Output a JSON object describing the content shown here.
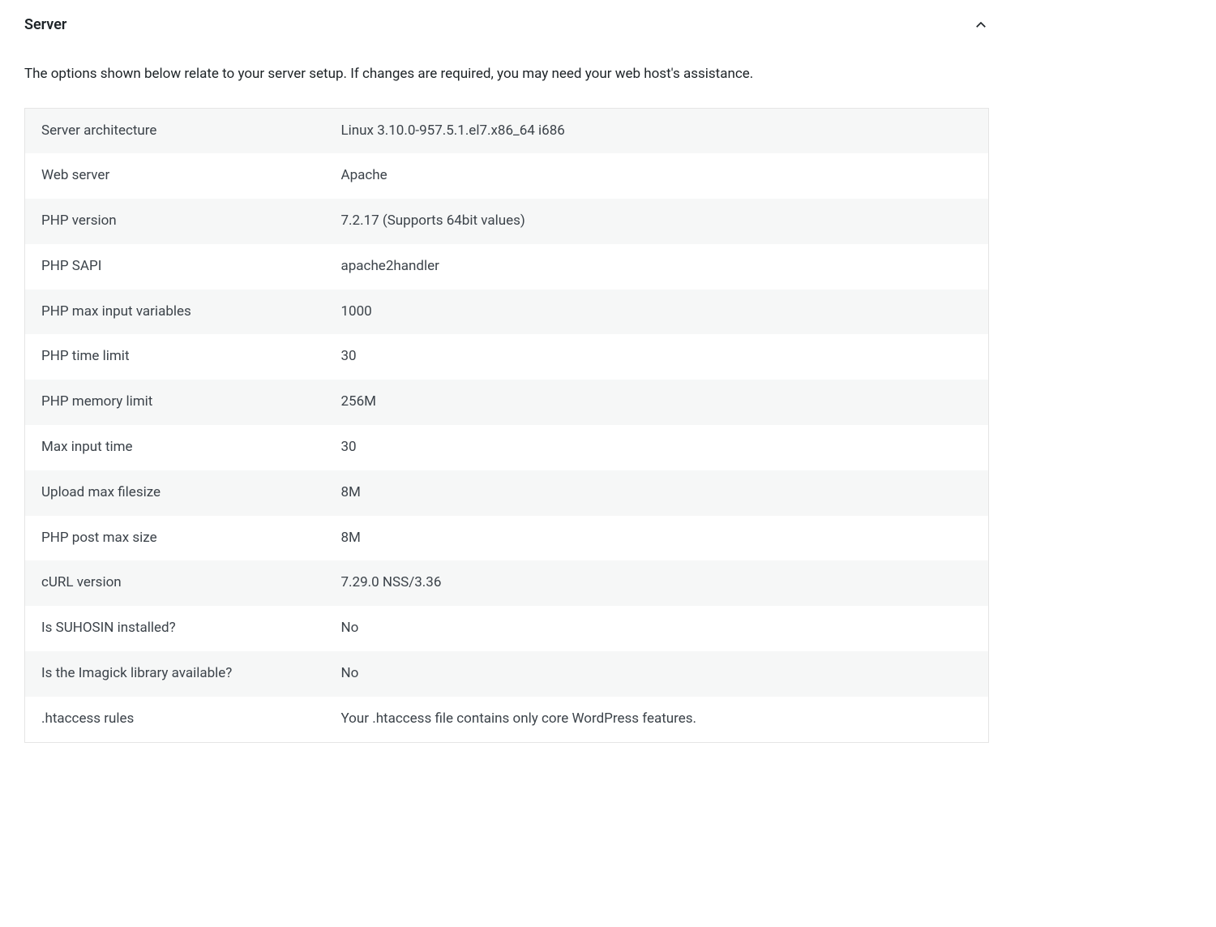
{
  "section": {
    "title": "Server",
    "description": "The options shown below relate to your server setup. If changes are required, you may need your web host's assistance."
  },
  "rows": [
    {
      "label": "Server architecture",
      "value": "Linux 3.10.0-957.5.1.el7.x86_64 i686"
    },
    {
      "label": "Web server",
      "value": "Apache"
    },
    {
      "label": "PHP version",
      "value": "7.2.17 (Supports 64bit values)"
    },
    {
      "label": "PHP SAPI",
      "value": "apache2handler"
    },
    {
      "label": "PHP max input variables",
      "value": "1000"
    },
    {
      "label": "PHP time limit",
      "value": "30"
    },
    {
      "label": "PHP memory limit",
      "value": "256M"
    },
    {
      "label": "Max input time",
      "value": "30"
    },
    {
      "label": "Upload max filesize",
      "value": "8M"
    },
    {
      "label": "PHP post max size",
      "value": "8M"
    },
    {
      "label": "cURL version",
      "value": "7.29.0 NSS/3.36"
    },
    {
      "label": "Is SUHOSIN installed?",
      "value": "No"
    },
    {
      "label": "Is the Imagick library available?",
      "value": "No"
    },
    {
      "label": ".htaccess rules",
      "value": "Your .htaccess file contains only core WordPress features."
    }
  ]
}
